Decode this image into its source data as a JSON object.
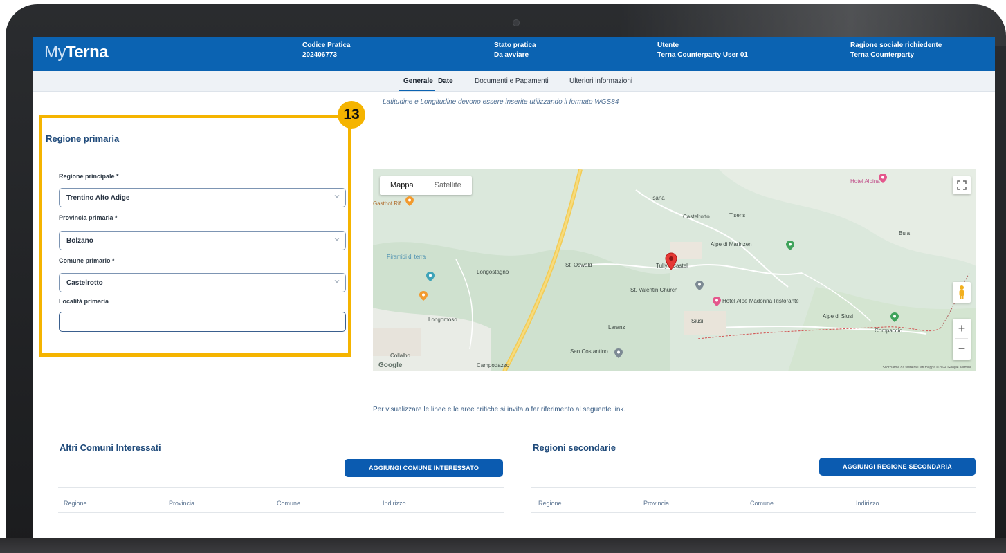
{
  "header": {
    "logo_my": "My",
    "logo_brand": "Terna",
    "columns": [
      {
        "label": "Codice Pratica",
        "value": "202406773"
      },
      {
        "label": "Stato pratica",
        "value": "Da avviare"
      },
      {
        "label": "Utente",
        "value": "Terna Counterparty User 01"
      },
      {
        "label": "Ragione sociale richiedente",
        "value": "Terna Counterparty"
      }
    ]
  },
  "tabs": [
    {
      "label": "Generale",
      "active": true
    },
    {
      "label": "Date",
      "active": false
    },
    {
      "label": "Documenti e Pagamenti",
      "active": false
    },
    {
      "label": "Ulteriori informazioni",
      "active": false
    }
  ],
  "hint": "Latitudine e Longitudine devono essere inserite utilizzando il formato WGS84",
  "primary_region": {
    "title": "Regione primaria",
    "region_label": "Regione principale *",
    "region_value": "Trentino Alto Adige",
    "province_label": "Provincia primaria *",
    "province_value": "Bolzano",
    "comune_label": "Comune primario *",
    "comune_value": "Castelrotto",
    "localita_label": "Località primaria",
    "localita_value": ""
  },
  "callout_number": "13",
  "map": {
    "type_map": "Mappa",
    "type_satellite": "Satellite",
    "labels": [
      "Tisana",
      "Castelrotto",
      "Tisens",
      "Bula",
      "Alpe di Marinzen",
      "Tullyn Castel",
      "St. Oswald",
      "Longostagno",
      "St. Valentin Church",
      "Hotel Alpe Madonna Ristorante",
      "Siusi",
      "Laranz",
      "Compaccio",
      "Alpe di Siusi",
      "San Costantino",
      "Longomoso",
      "Collalbo",
      "Campodazzo",
      "Piramidi di terra",
      "Hotel Alpina",
      "Gasthof Rif"
    ],
    "google": "Google",
    "attribution": "Scorciatoie da tastiera   Dati mappa ©2024 Google   Termini",
    "zoom_in": "+",
    "zoom_out": "−"
  },
  "link_text": "Per visualizzare le linee e le aree critiche si invita a far riferimento al seguente link.",
  "altri_comuni": {
    "title": "Altri Comuni Interessati",
    "button": "AGGIUNGI COMUNE INTERESSATO",
    "columns": [
      "Regione",
      "Provincia",
      "Comune",
      "Indirizzo"
    ]
  },
  "regioni_secondarie": {
    "title": "Regioni secondarie",
    "button": "AGGIUNGI REGIONE SECONDARIA",
    "columns": [
      "Regione",
      "Provincia",
      "Comune",
      "Indirizzo"
    ]
  },
  "colors": {
    "brand_blue": "#0b63b2",
    "highlight": "#f5b400"
  }
}
